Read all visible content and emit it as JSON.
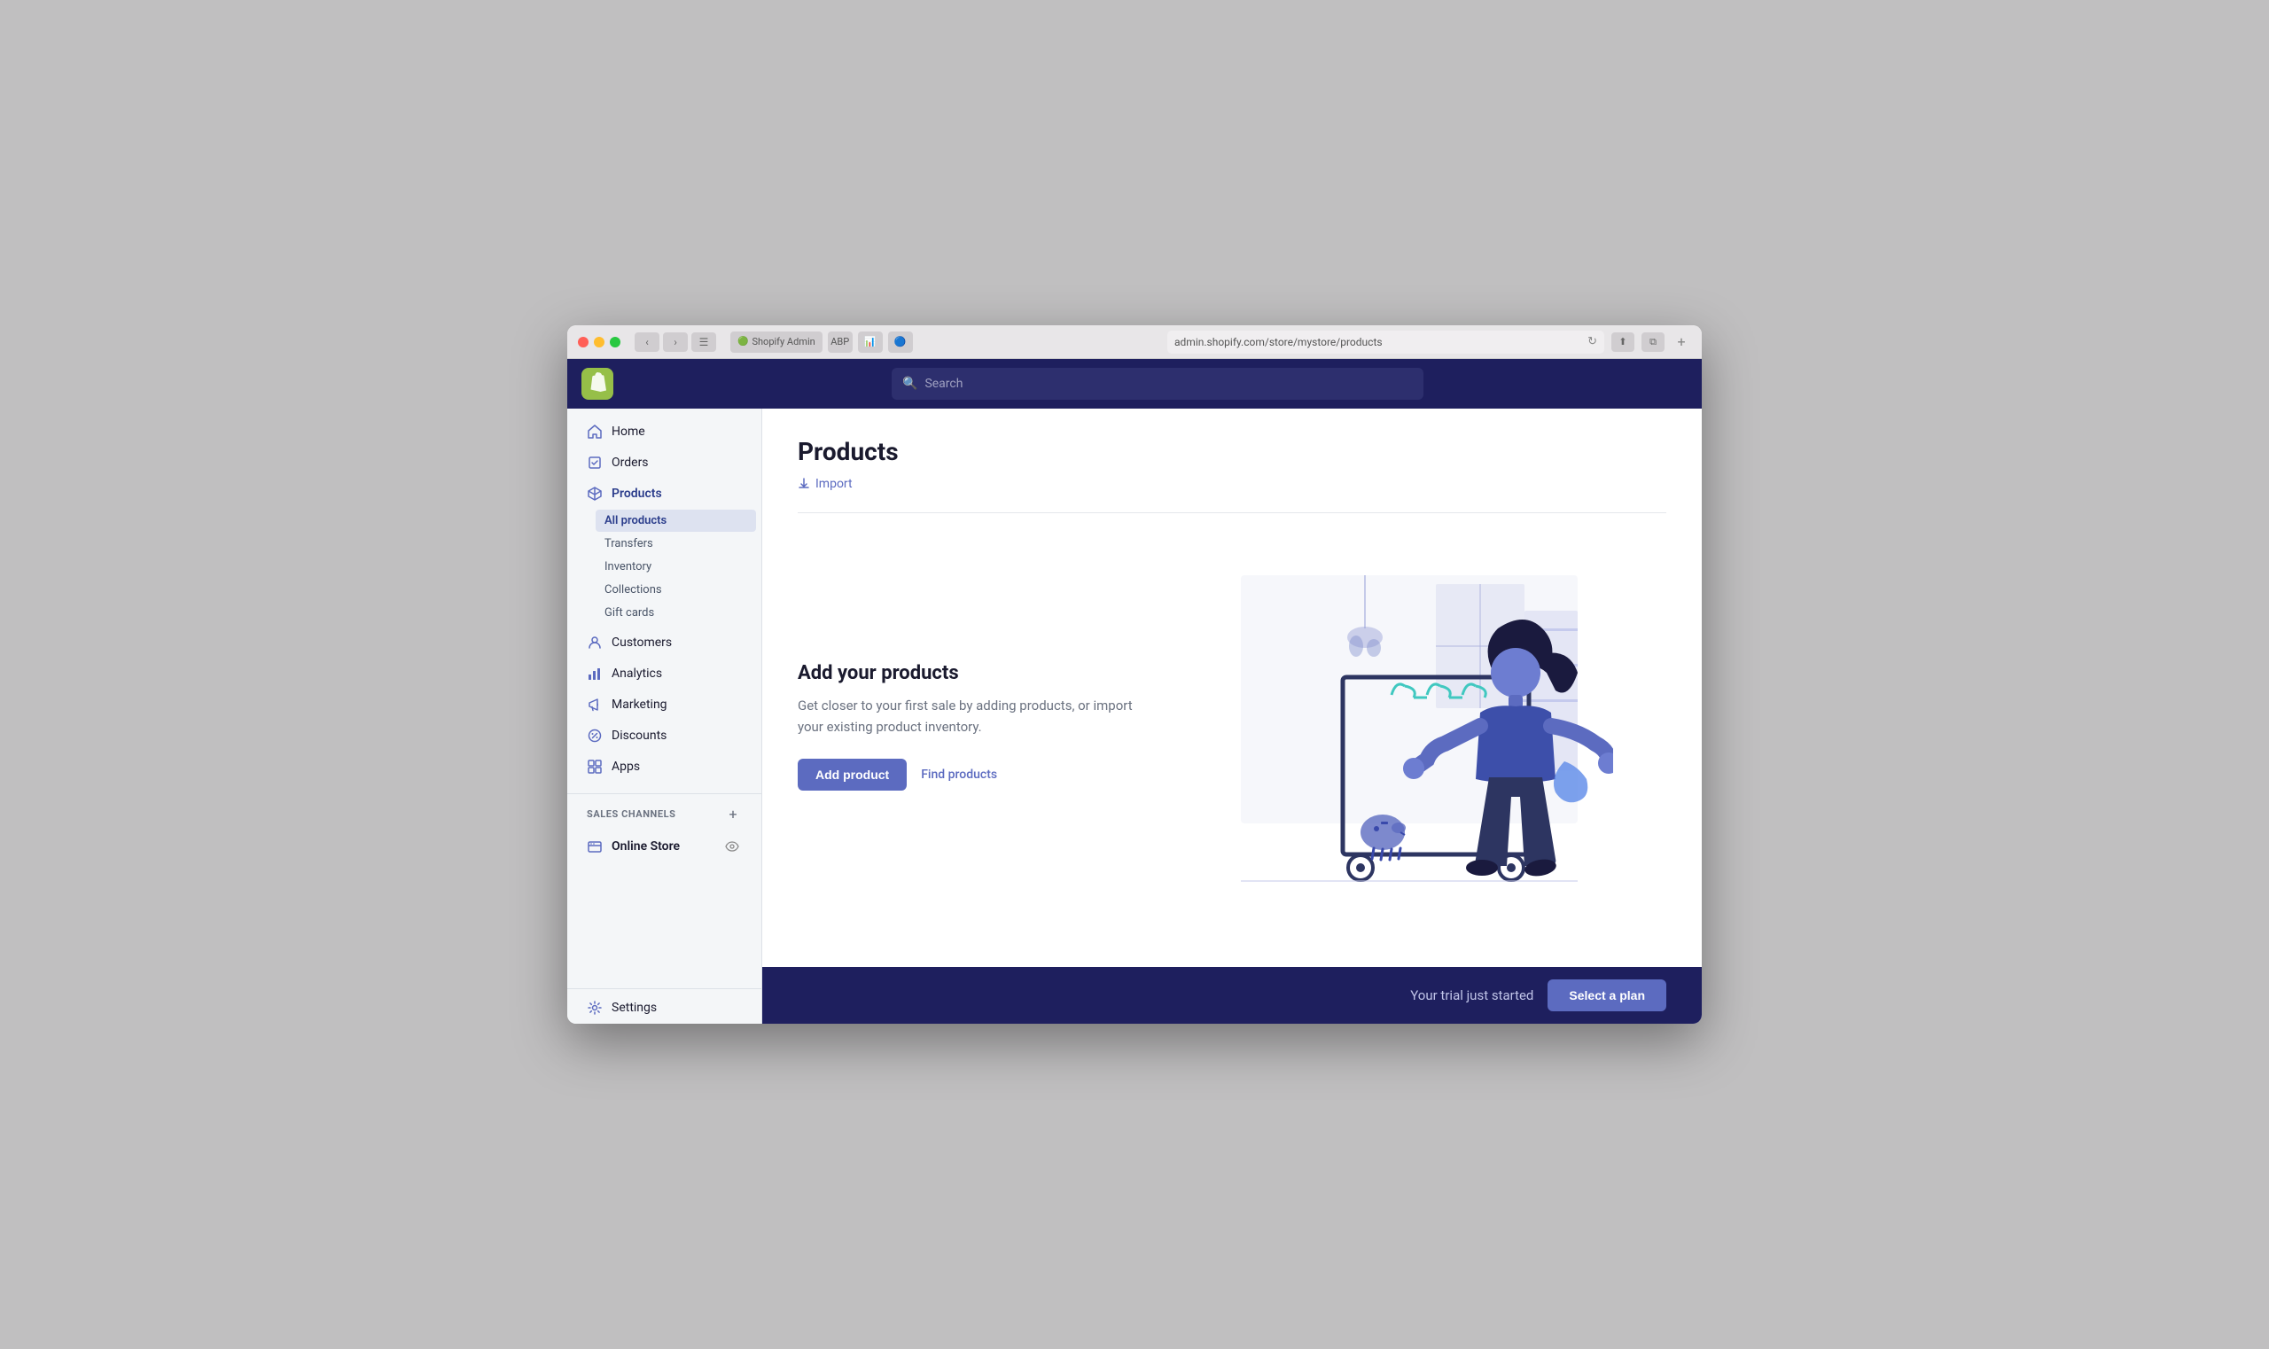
{
  "browser": {
    "dots": [
      "red",
      "yellow",
      "green"
    ],
    "address": "admin.shopify.com/store/mystore/products",
    "refresh_icon": "↻",
    "nav_back": "‹",
    "nav_forward": "›",
    "tab_label": "Shopify Admin",
    "new_tab": "+"
  },
  "topnav": {
    "logo_letter": "S",
    "search_placeholder": "Search"
  },
  "sidebar": {
    "items": [
      {
        "id": "home",
        "label": "Home",
        "icon": "⌂"
      },
      {
        "id": "orders",
        "label": "Orders",
        "icon": "↑"
      },
      {
        "id": "products",
        "label": "Products",
        "icon": "⬡",
        "active": true
      }
    ],
    "products_sub": [
      {
        "id": "all-products",
        "label": "All products",
        "active": true
      },
      {
        "id": "transfers",
        "label": "Transfers"
      },
      {
        "id": "inventory",
        "label": "Inventory"
      },
      {
        "id": "collections",
        "label": "Collections"
      },
      {
        "id": "gift-cards",
        "label": "Gift cards"
      }
    ],
    "other_items": [
      {
        "id": "customers",
        "label": "Customers",
        "icon": "👤"
      },
      {
        "id": "analytics",
        "label": "Analytics",
        "icon": "📊"
      },
      {
        "id": "marketing",
        "label": "Marketing",
        "icon": "📣"
      },
      {
        "id": "discounts",
        "label": "Discounts",
        "icon": "🏷"
      },
      {
        "id": "apps",
        "label": "Apps",
        "icon": "⊞"
      }
    ],
    "sales_channels_label": "SALES CHANNELS",
    "online_store_label": "Online Store",
    "settings_label": "Settings",
    "settings_icon": "⚙"
  },
  "main": {
    "page_title": "Products",
    "import_label": "Import",
    "empty_state": {
      "title": "Add your products",
      "description": "Get closer to your first sale by adding products, or import your existing product inventory.",
      "add_btn": "Add product",
      "find_link": "Find products"
    }
  },
  "bottom_bar": {
    "trial_text": "Your trial just started",
    "select_plan_btn": "Select a plan"
  }
}
